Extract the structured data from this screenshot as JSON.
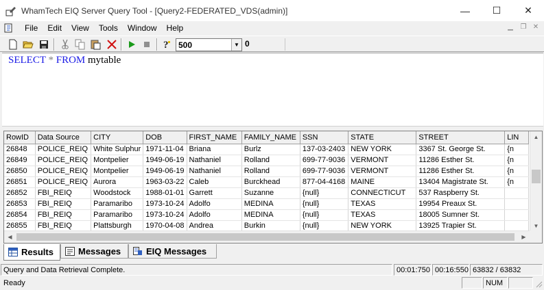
{
  "window": {
    "title": "WhamTech EIQ Server Query Tool - [Query2-FEDERATED_VDS(admin)]",
    "minimize_glyph": "—",
    "maximize_glyph": "☐",
    "close_glyph": "✕"
  },
  "menu": {
    "items": [
      "File",
      "Edit",
      "View",
      "Tools",
      "Window",
      "Help"
    ]
  },
  "toolbar": {
    "icons": [
      "new-file-icon",
      "open-folder-icon",
      "save-icon",
      "cut-icon",
      "copy-icon",
      "paste-icon",
      "delete-icon",
      "run-icon",
      "stop-icon",
      "help-icon"
    ],
    "max_rows_value": "500",
    "row_count": "0"
  },
  "editor": {
    "kw_select": "SELECT",
    "star": "*",
    "kw_from": "FROM",
    "table_name": "mytable"
  },
  "results": {
    "columns": [
      "RowID",
      "Data Source",
      "CITY",
      "DOB",
      "FIRST_NAME",
      "FAMILY_NAME",
      "SSN",
      "STATE",
      "STREET",
      "LIN"
    ],
    "rows": [
      [
        "26848",
        "POLICE_REIQ",
        "White Sulphur",
        "1971-11-04",
        "Briana",
        "Burlz",
        "137-03-2403",
        "NEW YORK",
        "3367 St. George St.",
        "{n"
      ],
      [
        "26849",
        "POLICE_REIQ",
        "Montpelier",
        "1949-06-19",
        "Nathaniel",
        "Rolland",
        "699-77-9036",
        "VERMONT",
        "11286 Esther St.",
        "{n"
      ],
      [
        "26850",
        "POLICE_REIQ",
        "Montpelier",
        "1949-06-19",
        "Nathaniel",
        "Rolland",
        "699-77-9036",
        "VERMONT",
        "11286 Esther St.",
        "{n"
      ],
      [
        "26851",
        "POLICE_REIQ",
        "Aurora",
        "1963-03-22",
        "Caleb",
        "Burckhead",
        "877-04-4168",
        "MAINE",
        "13404 Magistrate St.",
        "{n"
      ],
      [
        "26852",
        "FBI_REIQ",
        "Woodstock",
        "1988-01-01",
        "Garrett",
        "Suzanne",
        "{null}",
        "CONNECTICUT",
        "537 Raspberry St.",
        ""
      ],
      [
        "26853",
        "FBI_REIQ",
        "Paramaribo",
        "1973-10-24",
        "Adolfo",
        "MEDINA",
        "{null}",
        "TEXAS",
        "19954 Preaux St.",
        ""
      ],
      [
        "26854",
        "FBI_REIQ",
        "Paramaribo",
        "1973-10-24",
        "Adolfo",
        "MEDINA",
        "{null}",
        "TEXAS",
        "18005 Sumner St.",
        ""
      ],
      [
        "26855",
        "FBI_REIQ",
        "Plattsburgh",
        "1970-04-08",
        "Andrea",
        "Burkin",
        "{null}",
        "NEW YORK",
        "13925 Trapier St.",
        ""
      ]
    ]
  },
  "tabs": [
    {
      "label": "Results",
      "icon": "results-grid-icon",
      "active": true
    },
    {
      "label": "Messages",
      "icon": "messages-icon",
      "active": false
    },
    {
      "label": "EIQ Messages",
      "icon": "eiq-messages-icon",
      "active": false
    }
  ],
  "status": {
    "message": "Query and Data Retrieval Complete.",
    "time1": "00:01:750",
    "time2": "00:16:550",
    "rows": "63832 / 63832",
    "ready": "Ready",
    "num": "NUM"
  },
  "colors": {
    "sql_keyword": "#1a1ae6",
    "run_green": "#1a9a1a",
    "delete_red": "#d01010"
  }
}
